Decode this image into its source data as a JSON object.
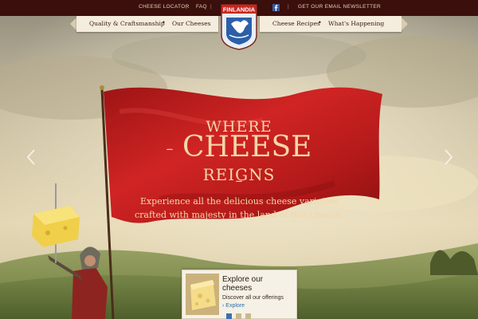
{
  "utility_nav": {
    "cheese_locator": "CHEESE LOCATOR",
    "sep1": "|",
    "faq": "FAQ",
    "sep2": "|",
    "facebook_icon": "facebook-icon",
    "sep3": "|",
    "newsletter": "GET OUR EMAIL NEWSLETTER"
  },
  "main_nav": {
    "left": [
      "Quality & Craftsmanship",
      "Our Cheeses"
    ],
    "right": [
      "Cheese Recipes",
      "What's Happening"
    ],
    "separator": "•"
  },
  "logo": {
    "text": "FINLANDIA"
  },
  "hero": {
    "line1": "WHERE",
    "line2": "CHEESE",
    "line3": "REIGNS",
    "dash": "–",
    "desc1": "Experience all the delicious cheese varieties",
    "desc2": "crafted with majesty in the land of  fine cheese."
  },
  "carousel": {
    "prev_icon": "chevron-left-icon",
    "next_icon": "chevron-right-icon"
  },
  "promo": {
    "title": "Explore our cheeses",
    "subtitle": "Discover all our offerings",
    "link": "› Explore"
  },
  "colors": {
    "topbar": "#3a0f0c",
    "flag_red": "#c11d1d",
    "headline_gold": "#f3d7a6",
    "link_blue": "#2b6fa8"
  }
}
